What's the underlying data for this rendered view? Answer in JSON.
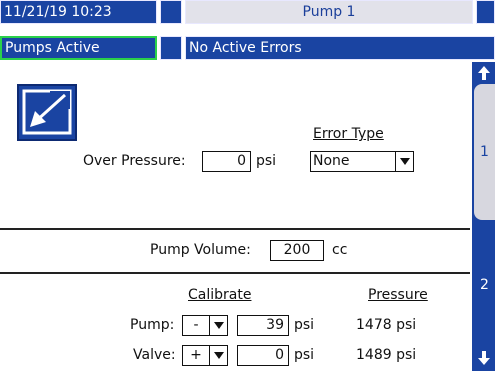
{
  "header": {
    "datetime": "11/21/19 10:23",
    "title": "Pump 1",
    "status": "Pumps Active",
    "errors": "No Active Errors"
  },
  "colors": {
    "header_bg": "#1a44a2",
    "status_green": "#2bd04a",
    "side_tab": "#d7d7df"
  },
  "icons": {
    "edit": "edit-arrow-icon",
    "scroll_up": "arrow-up-icon",
    "scroll_down": "arrow-down-icon"
  },
  "settings": {
    "over_pressure_label": "Over Pressure:",
    "over_pressure_value": "0",
    "over_pressure_unit": "psi",
    "error_type_label": "Error Type",
    "error_type_value": "None"
  },
  "volume": {
    "label": "Pump Volume:",
    "value": "200",
    "unit": "cc"
  },
  "calibrate": {
    "header": "Calibrate",
    "pressure_header": "Pressure",
    "rows": [
      {
        "label": "Pump:",
        "sign": "-",
        "value": "39",
        "unit": "psi",
        "pressure": "1478 psi"
      },
      {
        "label": "Valve:",
        "sign": "+",
        "value": "0",
        "unit": "psi",
        "pressure": "1489 psi"
      }
    ]
  },
  "side_tabs": [
    "1",
    "2"
  ]
}
